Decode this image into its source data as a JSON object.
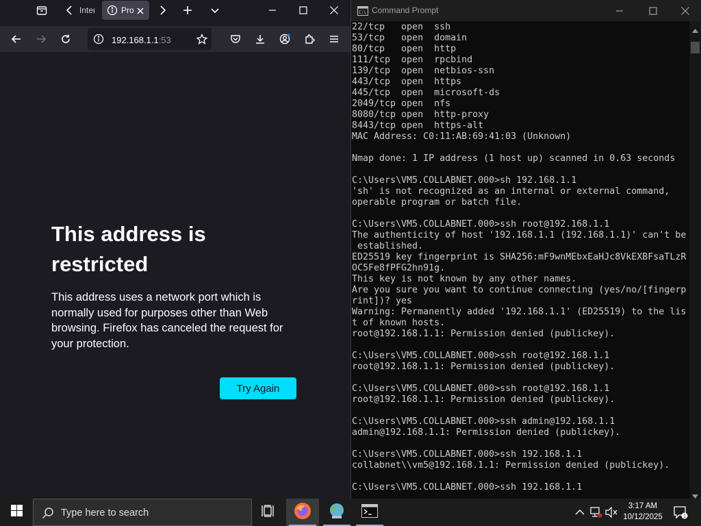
{
  "firefox": {
    "tabs": [
      {
        "label": "Inter"
      },
      {
        "label": "Problem loading page"
      }
    ],
    "url": {
      "host": "192.168.1.1",
      "port": ":53"
    },
    "error": {
      "title": "This address is restricted",
      "description": "This address uses a network port which is normally used for purposes other than Web browsing. Firefox has canceled the request for your protection.",
      "button": "Try Again"
    }
  },
  "cmd": {
    "title": "Command Prompt",
    "lines": [
      "22/tcp   open  ssh",
      "53/tcp   open  domain",
      "80/tcp   open  http",
      "111/tcp  open  rpcbind",
      "139/tcp  open  netbios-ssn",
      "443/tcp  open  https",
      "445/tcp  open  microsoft-ds",
      "2049/tcp open  nfs",
      "8080/tcp open  http-proxy",
      "8443/tcp open  https-alt",
      "MAC Address: C0:11:AB:69:41:03 (Unknown)",
      "",
      "Nmap done: 1 IP address (1 host up) scanned in 0.63 seconds",
      "",
      "C:\\Users\\VM5.COLLABNET.000>sh 192.168.1.1",
      "'sh' is not recognized as an internal or external command,",
      "operable program or batch file.",
      "",
      "C:\\Users\\VM5.COLLABNET.000>ssh root@192.168.1.1",
      "The authenticity of host '192.168.1.1 (192.168.1.1)' can't be",
      " established.",
      "ED25519 key fingerprint is SHA256:mF9wnMEbxEaHJc8VkEXBFsaTLzR",
      "OC5Fe8fPFG2hn91g.",
      "This key is not known by any other names.",
      "Are you sure you want to continue connecting (yes/no/[fingerp",
      "rint])? yes",
      "Warning: Permanently added '192.168.1.1' (ED25519) to the lis",
      "t of known hosts.",
      "root@192.168.1.1: Permission denied (publickey).",
      "",
      "C:\\Users\\VM5.COLLABNET.000>ssh root@192.168.1.1",
      "root@192.168.1.1: Permission denied (publickey).",
      "",
      "C:\\Users\\VM5.COLLABNET.000>ssh root@192.168.1.1",
      "root@192.168.1.1: Permission denied (publickey).",
      "",
      "C:\\Users\\VM5.COLLABNET.000>ssh admin@192.168.1.1",
      "admin@192.168.1.1: Permission denied (publickey).",
      "",
      "C:\\Users\\VM5.COLLABNET.000>ssh 192.168.1.1",
      "collabnet\\\\vm5@192.168.1.1: Permission denied (publickey).",
      "",
      "C:\\Users\\VM5.COLLABNET.000>ssh 192.168.1.1"
    ]
  },
  "taskbar": {
    "search_placeholder": "Type here to search",
    "time": "3:17 AM",
    "date": "10/12/2025",
    "notification_count": "1"
  },
  "colors": {
    "accent": "#00ddff",
    "firefox_bg": "#1c1b22",
    "cmd_bg": "#0c0c0c"
  }
}
